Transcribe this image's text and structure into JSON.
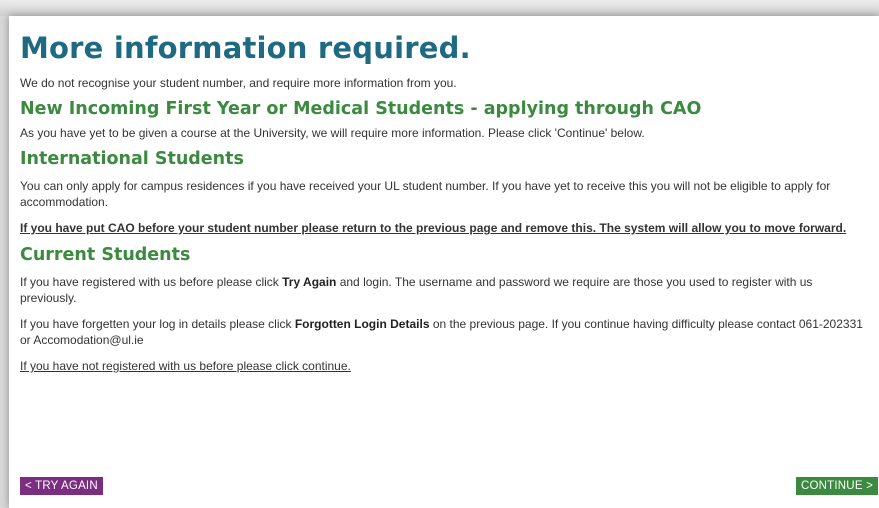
{
  "title": "More information required.",
  "intro": "We do not recognise your student number, and require more information from you.",
  "cao": {
    "heading": "New Incoming First Year or Medical Students - applying through CAO",
    "text": "As you have yet to be given a course at the University, we will require more information. Please click 'Continue' below."
  },
  "international": {
    "heading": "International Students",
    "text": "You can only apply for campus residences if you have received your UL student number. If you have yet to receive this you will not be eligible to apply for accommodation.",
    "warning": "If you have put CAO before your student number please return to the previous page and remove this. The system will allow you to move forward."
  },
  "current": {
    "heading": "Current Students",
    "p1_before": "If you have registered with us before please click ",
    "p1_bold": "Try Again",
    "p1_after": " and login. The username and password we require are those you used to register with us previously.",
    "p2_before": "If you have forgetten your log in details please click ",
    "p2_bold": "Forgotten Login Details",
    "p2_after": " on the previous page. If you continue having difficulty please contact 061-202331 or Accomodation@ul.ie",
    "register_link": "If you have not registered with us before please click continue."
  },
  "buttons": {
    "try_again": "< TRY AGAIN",
    "continue": "CONTINUE >"
  },
  "colors": {
    "title": "#1f6a83",
    "heading": "#3b8a3f",
    "try_again_bg": "#7b2d82",
    "continue_bg": "#3b8a3f"
  }
}
